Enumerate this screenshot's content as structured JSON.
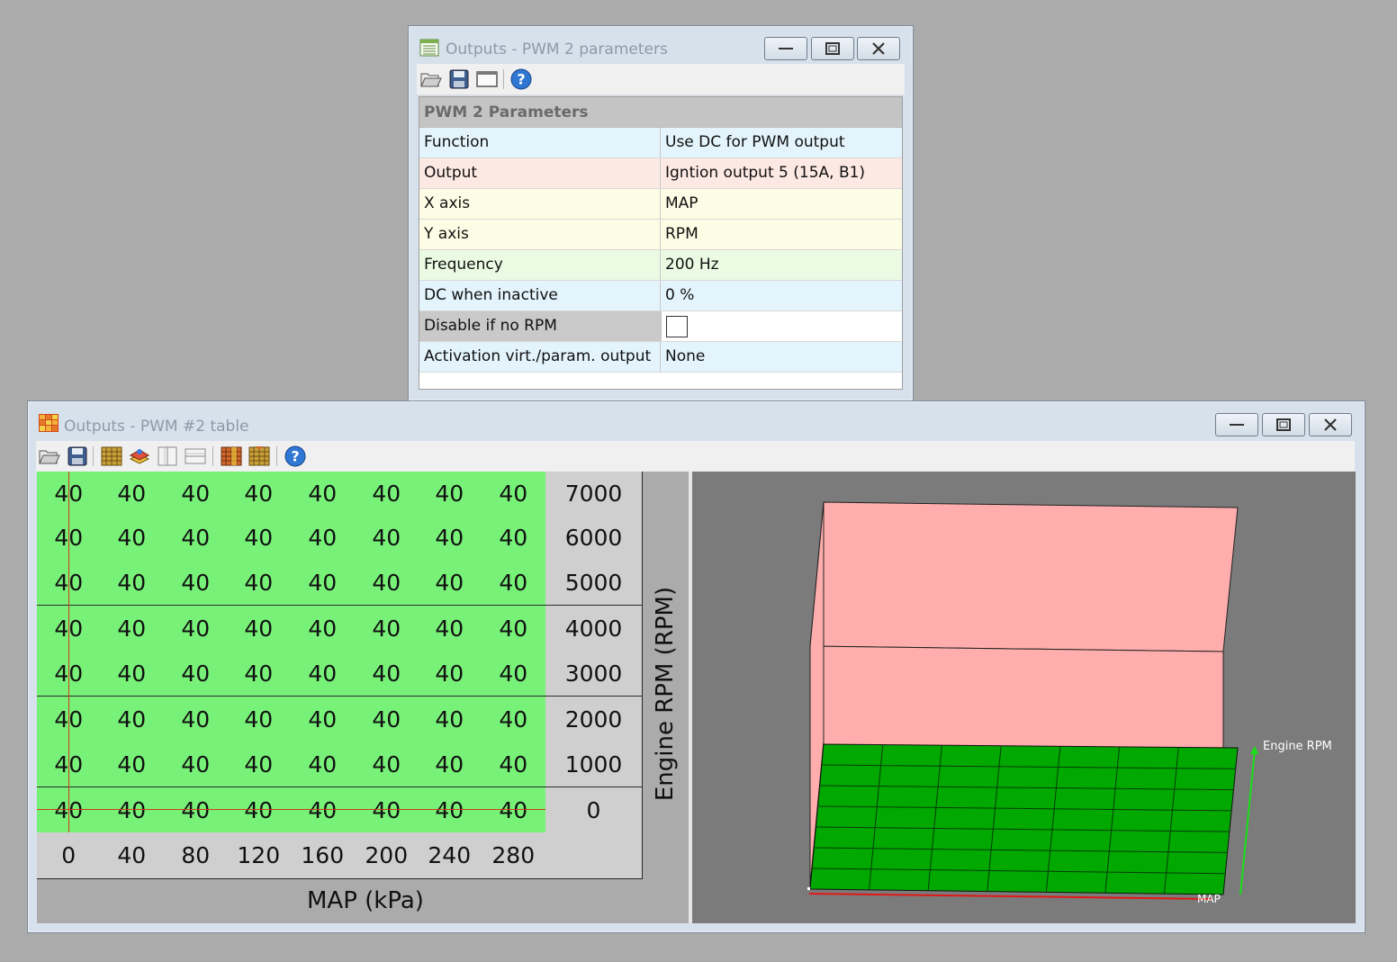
{
  "params_window": {
    "title": "Outputs - PWM 2 parameters",
    "section": "PWM 2 Parameters",
    "rows": [
      {
        "key": "Function",
        "value": "Use DC for PWM output",
        "color": "#e3f4fc"
      },
      {
        "key": "Output",
        "value": "Igntion output 5 (15A, B1)",
        "color": "#fce9e3"
      },
      {
        "key": "X axis",
        "value": "MAP",
        "color": "#fdfde6"
      },
      {
        "key": "Y axis",
        "value": "RPM",
        "color": "#fdfde6"
      },
      {
        "key": "Frequency",
        "value": "200 Hz",
        "color": "#ebfbe3"
      },
      {
        "key": "DC when inactive",
        "value": "0 %",
        "color": "#e3f4fc"
      },
      {
        "key": "Disable if no RPM",
        "value": "",
        "color": "#c9c9c9",
        "checkbox": true
      },
      {
        "key": "Activation virt./param. output",
        "value": "None",
        "color": "#e3f4fc"
      }
    ]
  },
  "table_window": {
    "title": "Outputs - PWM #2 table",
    "x_axis_label": "MAP (kPa)",
    "y_axis_label": "Engine RPM (RPM)",
    "x_values": [
      "0",
      "40",
      "80",
      "120",
      "160",
      "200",
      "240",
      "280"
    ],
    "y_values": [
      "7000",
      "6000",
      "5000",
      "4000",
      "3000",
      "2000",
      "1000",
      "0"
    ],
    "cells": [
      [
        "40",
        "40",
        "40",
        "40",
        "40",
        "40",
        "40",
        "40"
      ],
      [
        "40",
        "40",
        "40",
        "40",
        "40",
        "40",
        "40",
        "40"
      ],
      [
        "40",
        "40",
        "40",
        "40",
        "40",
        "40",
        "40",
        "40"
      ],
      [
        "40",
        "40",
        "40",
        "40",
        "40",
        "40",
        "40",
        "40"
      ],
      [
        "40",
        "40",
        "40",
        "40",
        "40",
        "40",
        "40",
        "40"
      ],
      [
        "40",
        "40",
        "40",
        "40",
        "40",
        "40",
        "40",
        "40"
      ],
      [
        "40",
        "40",
        "40",
        "40",
        "40",
        "40",
        "40",
        "40"
      ],
      [
        "40",
        "40",
        "40",
        "40",
        "40",
        "40",
        "40",
        "40"
      ]
    ],
    "view3d": {
      "x_axis_label": "MAP",
      "y_axis_label": "Engine RPM",
      "surface_color": "#00a800",
      "wall_color": "#ffadad"
    }
  }
}
